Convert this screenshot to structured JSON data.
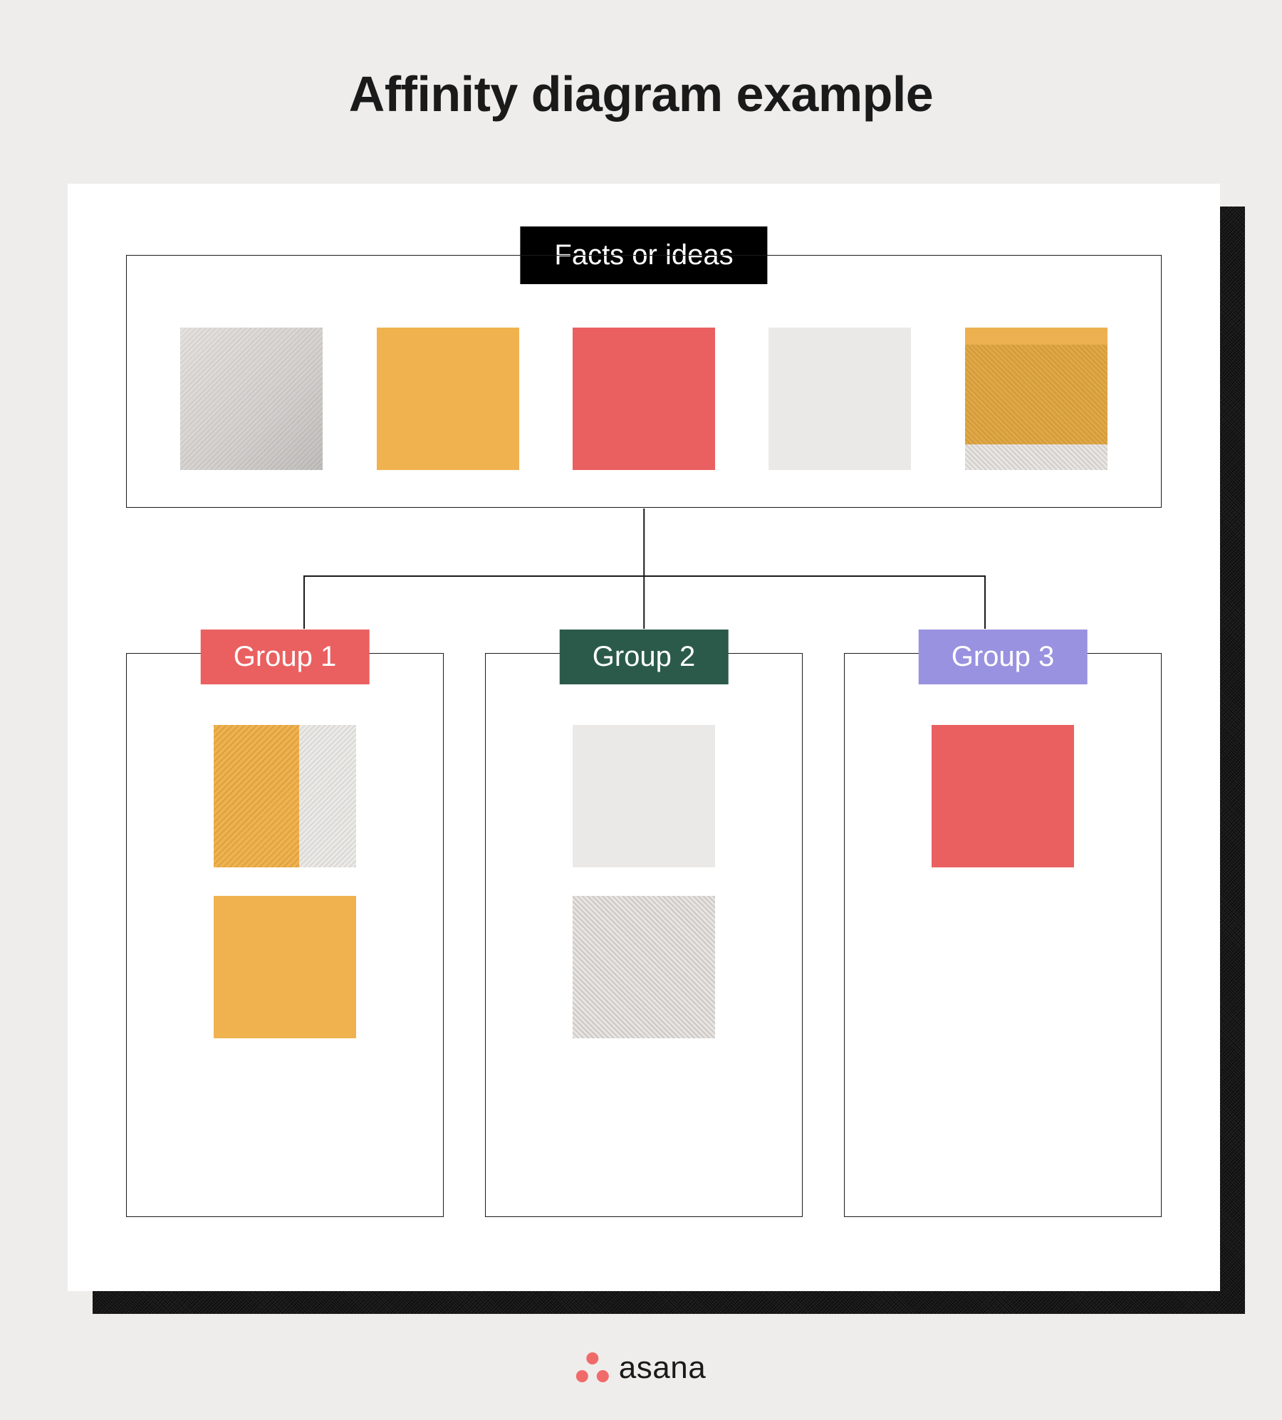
{
  "title": "Affinity diagram example",
  "facts": {
    "label": "Facts or ideas",
    "swatches": [
      {
        "variant": "grey-textured"
      },
      {
        "variant": "yellow"
      },
      {
        "variant": "red"
      },
      {
        "variant": "grey-flat"
      },
      {
        "variant": "yellow-textured"
      }
    ]
  },
  "groups": [
    {
      "label": "Group 1",
      "color": "#ea6060",
      "swatches": [
        {
          "variant": "yellow-dual"
        },
        {
          "variant": "yellow"
        }
      ]
    },
    {
      "label": "Group 2",
      "color": "#2b5a4b",
      "swatches": [
        {
          "variant": "grey-flat"
        },
        {
          "variant": "grey-textured-2"
        }
      ]
    },
    {
      "label": "Group 3",
      "color": "#9992e0",
      "swatches": [
        {
          "variant": "red"
        }
      ]
    }
  ],
  "brand": {
    "name": "asana",
    "icon_color": "#f06a6a"
  }
}
